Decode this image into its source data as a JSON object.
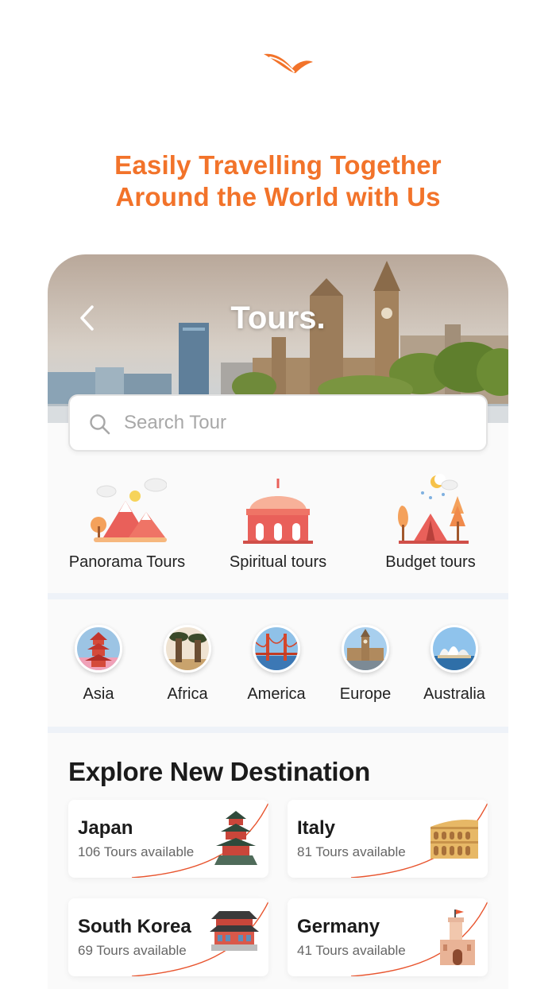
{
  "headline": {
    "line1": "Easily Travelling Together",
    "line2": "Around the World with Us"
  },
  "header": {
    "title": "Tours.",
    "back_icon": "chevron-left-icon"
  },
  "search": {
    "placeholder": "Search Tour",
    "icon": "search-icon"
  },
  "categories": [
    {
      "label": "Panorama Tours",
      "icon": "mountain-icon"
    },
    {
      "label": "Spiritual tours",
      "icon": "mosque-icon"
    },
    {
      "label": "Budget tours",
      "icon": "tent-icon"
    }
  ],
  "regions": [
    {
      "label": "Asia",
      "icon": "pagoda-icon"
    },
    {
      "label": "Africa",
      "icon": "baobab-icon"
    },
    {
      "label": "America",
      "icon": "golden-gate-icon"
    },
    {
      "label": "Europe",
      "icon": "big-ben-icon"
    },
    {
      "label": "Australia",
      "icon": "opera-house-icon"
    }
  ],
  "explore": {
    "title": "Explore New Destination",
    "destinations": [
      {
        "name": "Japan",
        "tours": "106 Tours available",
        "icon": "japanese-castle-icon"
      },
      {
        "name": "Italy",
        "tours": "81 Tours available",
        "icon": "colosseum-icon"
      },
      {
        "name": "South Korea",
        "tours": "69 Tours available",
        "icon": "korean-palace-icon"
      },
      {
        "name": "Germany",
        "tours": "41 Tours available",
        "icon": "castle-tower-icon"
      }
    ]
  },
  "colors": {
    "accent": "#f2732a",
    "curve": "#e8552f",
    "band": "#eef2f8"
  }
}
